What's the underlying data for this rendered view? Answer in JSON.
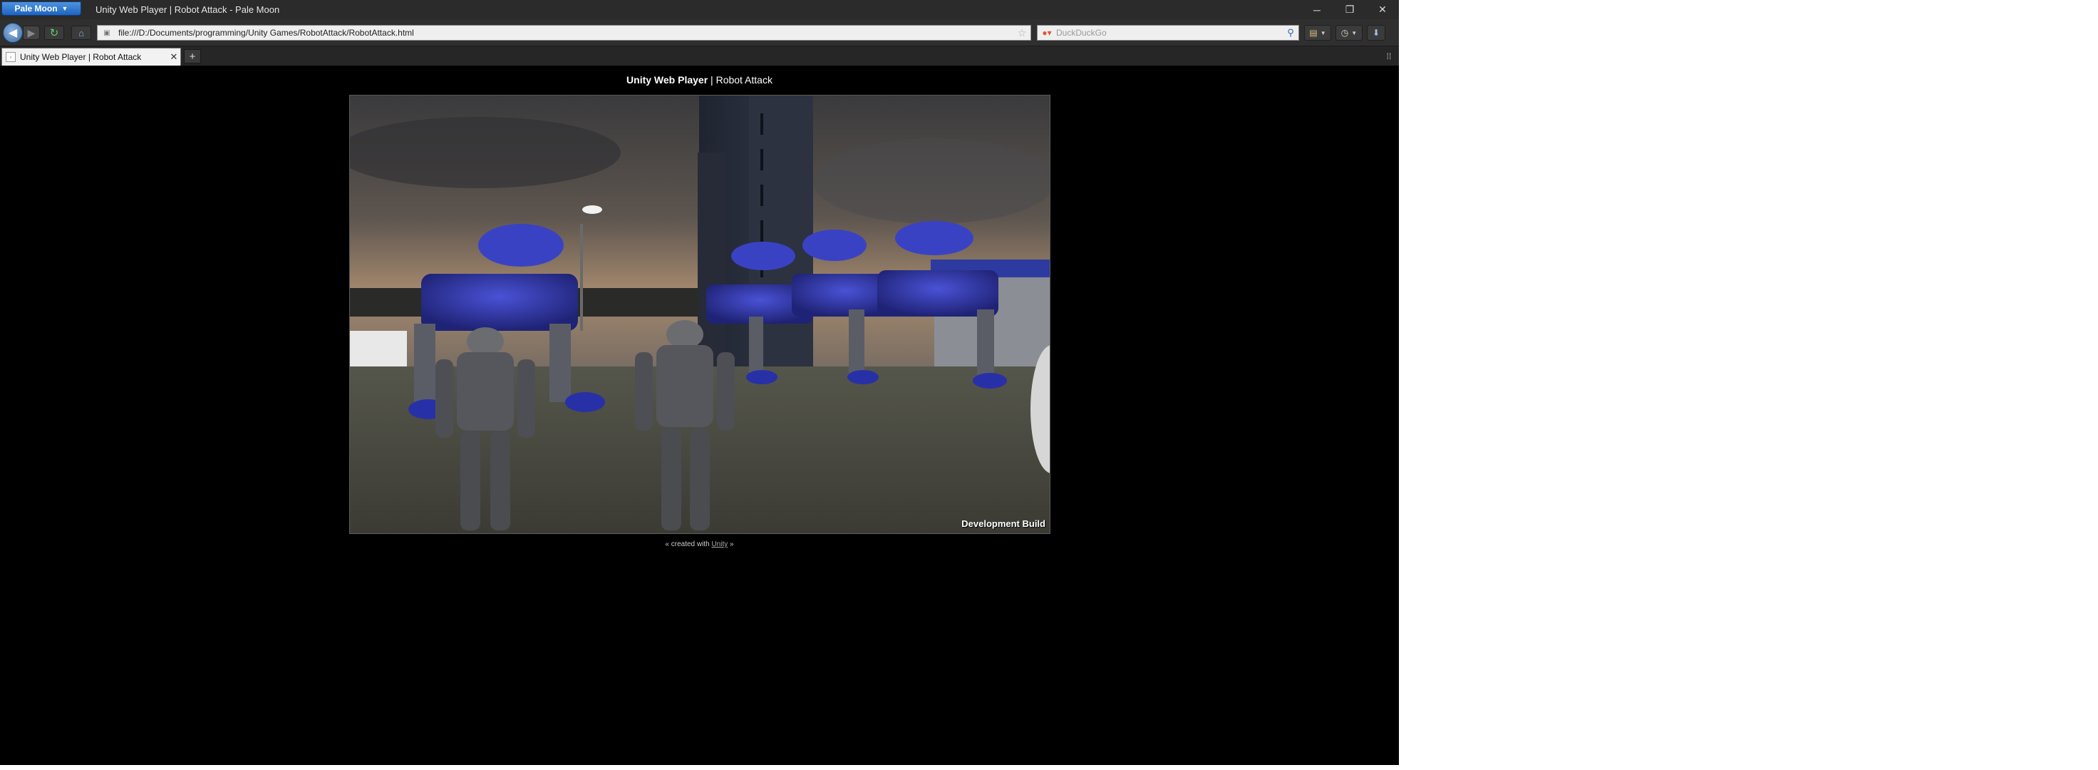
{
  "titlebar": {
    "app_menu_label": "Pale Moon",
    "window_title": "Unity Web Player | Robot Attack - Pale Moon",
    "minimize_glyph": "─",
    "restore_glyph": "❐",
    "close_glyph": "✕"
  },
  "navbar": {
    "url": "file:///D:/Documents/programming/Unity Games/RobotAttack/RobotAttack.html",
    "search_placeholder": "DuckDuckGo",
    "icons": [
      "back-arrow-icon",
      "forward-arrow-icon",
      "reload-icon",
      "home-icon",
      "site-identity-icon",
      "bookmark-star-icon",
      "duckduckgo-icon",
      "search-magnifier-icon",
      "bookmarks-menu-icon",
      "history-icon",
      "downloads-icon"
    ]
  },
  "tabs": [
    {
      "label": "Unity Web Player | Robot Attack",
      "active": true
    }
  ],
  "page": {
    "title_bold": "Unity Web Player",
    "title_separator": " | ",
    "title_rest": "Robot Attack",
    "dev_build_label": "Development Build",
    "footer_prefix": "« created with ",
    "footer_link": "Unity",
    "footer_suffix": " »"
  },
  "scene": {
    "description_objects": [
      "sky",
      "skyscraper",
      "blue-walker-robots",
      "grey-humanoid-robots",
      "street-lamp",
      "ground"
    ],
    "colors": {
      "sky": "#4a4744",
      "sky_glow": "#a88a6d",
      "building": "#2a2f3c",
      "robot_blue": "#2a2f9e",
      "robot_grey": "#595b60",
      "ground": "#4a4b42"
    }
  }
}
